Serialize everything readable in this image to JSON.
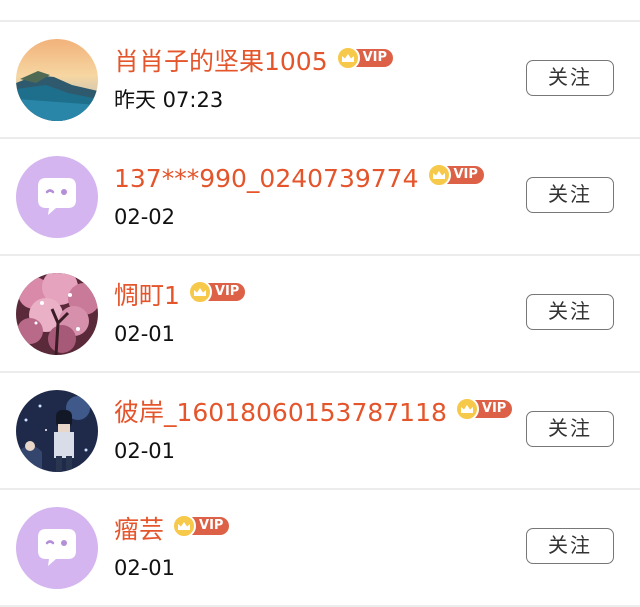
{
  "users": [
    {
      "name": "肖肖子的坚果1005",
      "time": "昨天 07:23",
      "vip": "VIP",
      "follow": "关注",
      "avatar": "landscape-avatar"
    },
    {
      "name": "137***990_0240739774",
      "time": "02-02",
      "vip": "VIP",
      "follow": "关注",
      "avatar": "default-avatar"
    },
    {
      "name": "惆町1",
      "time": "02-01",
      "vip": "VIP",
      "follow": "关注",
      "avatar": "blossom-avatar"
    },
    {
      "name": "彼岸_16018060153787118",
      "time": "02-01",
      "vip": "VIP",
      "follow": "关注",
      "avatar": "anime-avatar"
    },
    {
      "name": "瘤芸",
      "time": "02-01",
      "vip": "VIP",
      "follow": "关注",
      "avatar": "default-avatar"
    }
  ],
  "colors": {
    "username": "#e4552b",
    "vip_badge": "#dc6146",
    "vip_crown": "#f6c94a",
    "default_avatar": "#d4b5f0"
  }
}
